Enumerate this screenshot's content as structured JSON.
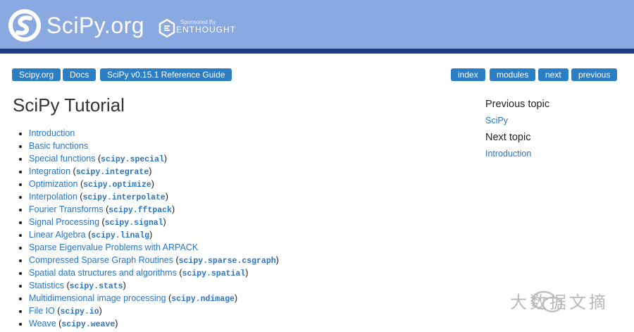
{
  "header": {
    "logo_text": "SciPy.org",
    "sponsor_prefix": "Sponsored By",
    "sponsor_name": "ENTHOUGHT",
    "background_color": "#8aa9e0",
    "stripe_color": "#1a3a8a"
  },
  "breadcrumbs": {
    "items": [
      "Scipy.org",
      "Docs",
      "SciPy v0.15.1 Reference Guide"
    ]
  },
  "related_nav": {
    "items": [
      "index",
      "modules",
      "next",
      "previous"
    ]
  },
  "page_title": "SciPy Tutorial",
  "toc": [
    {
      "label": "Introduction",
      "module": ""
    },
    {
      "label": "Basic functions",
      "module": ""
    },
    {
      "label": "Special functions",
      "module": "scipy.special"
    },
    {
      "label": "Integration",
      "module": "scipy.integrate"
    },
    {
      "label": "Optimization",
      "module": "scipy.optimize"
    },
    {
      "label": "Interpolation",
      "module": "scipy.interpolate"
    },
    {
      "label": "Fourier Transforms",
      "module": "scipy.fftpack"
    },
    {
      "label": "Signal Processing",
      "module": "scipy.signal"
    },
    {
      "label": "Linear Algebra",
      "module": "scipy.linalg"
    },
    {
      "label": "Sparse Eigenvalue Problems with ARPACK",
      "module": ""
    },
    {
      "label": "Compressed Sparse Graph Routines",
      "module": "scipy.sparse.csgraph"
    },
    {
      "label": "Spatial data structures and algorithms",
      "module": "scipy.spatial"
    },
    {
      "label": "Statistics",
      "module": "scipy.stats"
    },
    {
      "label": "Multidimensional image processing",
      "module": "scipy.ndimage"
    },
    {
      "label": "File IO",
      "module": "scipy.io"
    },
    {
      "label": "Weave",
      "module": "scipy.weave"
    }
  ],
  "sidebar": {
    "previous_heading": "Previous topic",
    "previous_link": "SciPy",
    "next_heading": "Next topic",
    "next_link": "Introduction"
  },
  "watermark": {
    "text": "大数据文摘",
    "icon": "wechat-icon"
  },
  "colors": {
    "link": "#2a74c5",
    "button": "#2b7dc4"
  }
}
